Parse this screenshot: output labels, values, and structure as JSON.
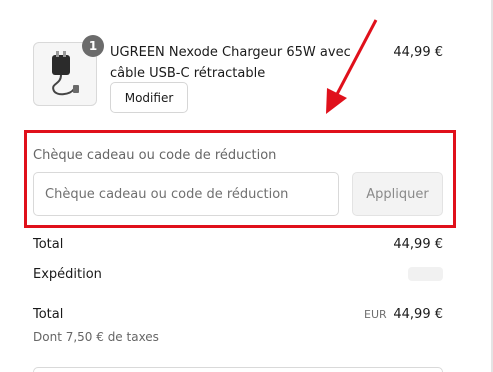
{
  "cart_item": {
    "quantity": "1",
    "name": "UGREEN Nexode Chargeur 65W avec câble USB-C rétractable",
    "price": "44,99 €",
    "modify_label": "Modifier",
    "image_icon": "charger-icon"
  },
  "discount": {
    "label": "Chèque cadeau ou code de réduction",
    "placeholder": "Chèque cadeau ou code de réduction",
    "value": "",
    "apply_label": "Appliquer"
  },
  "summary": {
    "subtotal_label": "Total",
    "subtotal_value": "44,99 €",
    "shipping_label": "Expédition",
    "total_label": "Total",
    "currency": "EUR",
    "total_value": "44,99 €",
    "taxes_note": "Dont 7,50 € de taxes"
  },
  "annotation": {
    "highlight_color": "#e0101b",
    "arrow_icon": "arrow-icon"
  }
}
